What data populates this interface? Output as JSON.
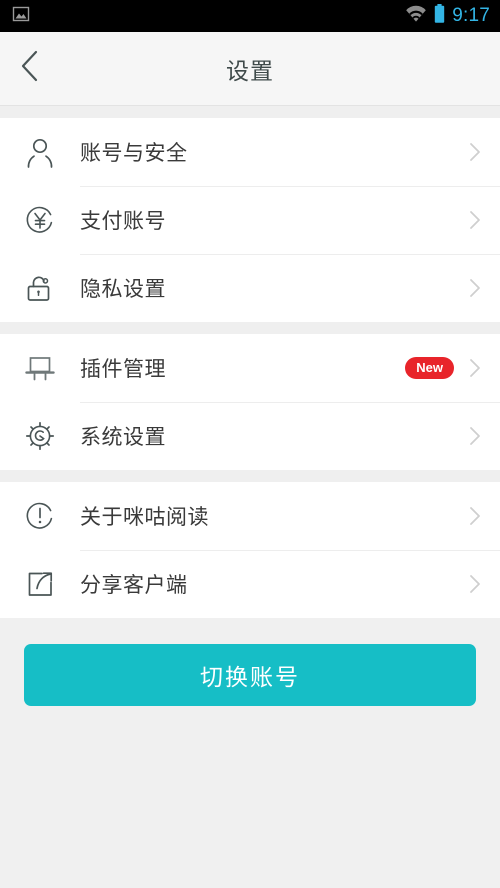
{
  "statusbar": {
    "time": "9:17",
    "icons": [
      "image-icon",
      "wifi-icon",
      "battery-icon"
    ]
  },
  "header": {
    "title": "设置",
    "back_icon": "chevron-left-icon"
  },
  "groups": [
    {
      "rows": [
        {
          "label": "账号与安全",
          "icon": "person-icon",
          "badge": "",
          "chevron": "chevron-right-icon"
        },
        {
          "label": "支付账号",
          "icon": "yen-circle-icon",
          "badge": "",
          "chevron": "chevron-right-icon"
        },
        {
          "label": "隐私设置",
          "icon": "unlock-icon",
          "badge": "",
          "chevron": "chevron-right-icon"
        }
      ]
    },
    {
      "rows": [
        {
          "label": "插件管理",
          "icon": "plugin-icon",
          "badge": "New",
          "chevron": "chevron-right-icon"
        },
        {
          "label": "系统设置",
          "icon": "gear-icon",
          "badge": "",
          "chevron": "chevron-right-icon"
        }
      ]
    },
    {
      "rows": [
        {
          "label": "关于咪咕阅读",
          "icon": "info-icon",
          "badge": "",
          "chevron": "chevron-right-icon"
        },
        {
          "label": "分享客户端",
          "icon": "share-icon",
          "badge": "",
          "chevron": "chevron-right-icon"
        }
      ]
    }
  ],
  "action": {
    "label": "切换账号"
  },
  "colors": {
    "accent": "#16bec6",
    "badge": "#e8242a",
    "status_time": "#33b5e5",
    "icon_stroke": "#4a5556",
    "text": "#3a3a3a",
    "page_bg": "#f0f0f0"
  }
}
